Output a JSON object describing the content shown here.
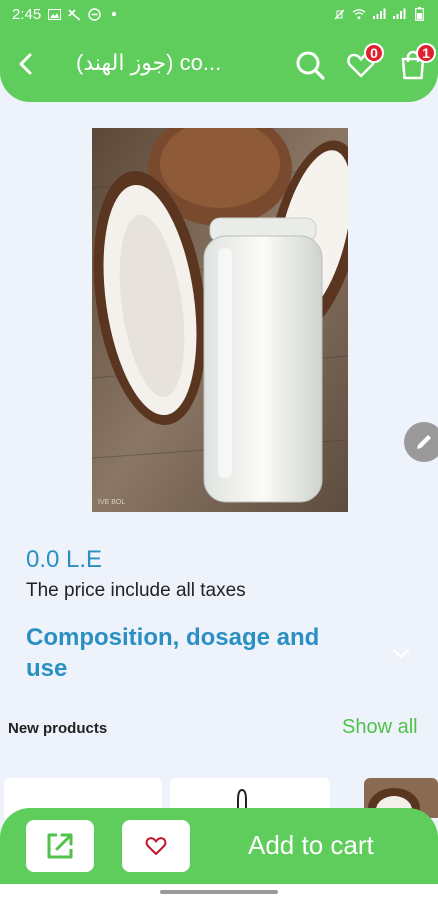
{
  "status_bar": {
    "time": "2:45"
  },
  "header": {
    "title": "(جوز الهند) co...",
    "wishlist_count": "0",
    "cart_count": "1"
  },
  "product": {
    "price": "0.0 L.E",
    "tax_note": "The price include all taxes",
    "section_title": "Composition, dosage and use"
  },
  "new_products": {
    "title": "New products",
    "show_all": "Show all"
  },
  "bottom_bar": {
    "add_to_cart": "Add to cart"
  },
  "colors": {
    "primary_green": "#5fcd5c",
    "accent_blue": "#2a8fc3",
    "badge_red": "#e0202e"
  },
  "icons": {
    "back": "chevron-left-icon",
    "search": "search-icon",
    "wishlist": "heart-icon",
    "cart": "shopping-bag-icon",
    "edit": "pencil-icon",
    "share": "share-external-icon",
    "favorite": "heart-outline-icon"
  }
}
